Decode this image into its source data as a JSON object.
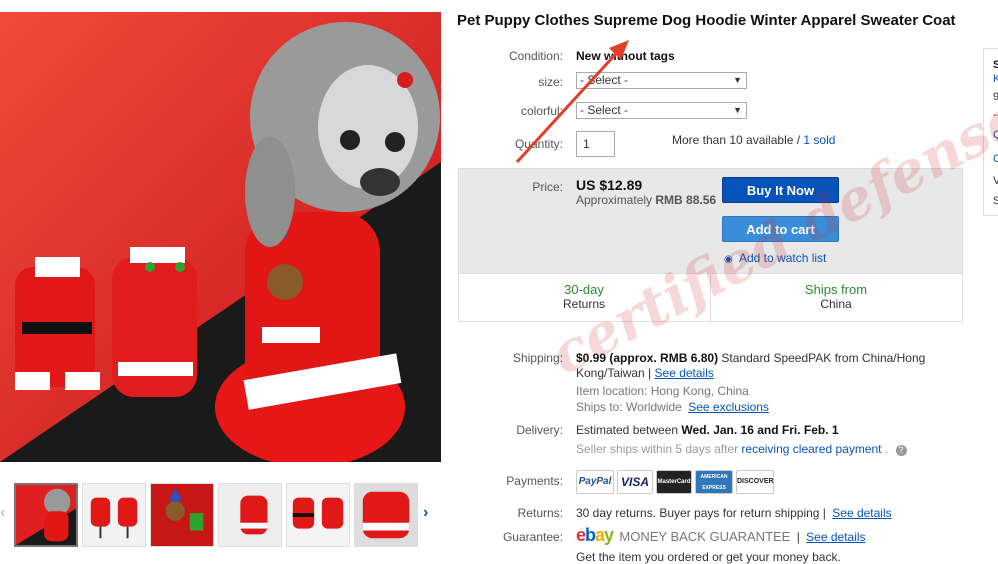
{
  "product": {
    "title": "Pet Puppy Clothes Supreme Dog Hoodie Winter Apparel Sweater Coat"
  },
  "options": {
    "condition_label": "Condition:",
    "condition_value": "New without tags",
    "size_label": "size:",
    "size_selected": "- Select -",
    "color_label": "colorful:",
    "color_selected": "- Select -",
    "quantity_label": "Quantity:",
    "quantity_value": "1",
    "available_text": "More than 10 available / ",
    "sold_link": "1 sold"
  },
  "price": {
    "label": "Price:",
    "value": "US $12.89",
    "approx_prefix": "Approximately ",
    "approx_value": "RMB 88.56",
    "buy_label": "Buy It Now",
    "cart_label": "Add to cart",
    "watch_label": "Add to watch list",
    "returns_highlight": "30-day",
    "returns_label": "Returns",
    "ships_highlight": "Ships from",
    "ships_label": "China"
  },
  "shipping": {
    "label": "Shipping:",
    "cost": "$0.99",
    "approx": "(approx. RMB 6.80)",
    "method_line1": "Standard SpeedPAK from China/Hong",
    "method_line2": "Kong/Taiwan |",
    "details_link": "See details",
    "location_label": "Item location:",
    "location_value": "Hong Kong, China",
    "ships_to_label": "Ships to:",
    "ships_to_value": "Worldwide",
    "exclusions_link": "See exclusions"
  },
  "delivery": {
    "label": "Delivery:",
    "prefix": "Estimated between ",
    "dates": "Wed. Jan. 16 and Fri. Feb. 1",
    "note": "Seller ships within 5 days after ",
    "note_link": "receiving cleared payment",
    "note_end": "."
  },
  "payments": {
    "label": "Payments:",
    "methods": [
      "PayPal",
      "VISA",
      "MasterCard",
      "AMERICAN EXPRESS",
      "DISCOVER"
    ]
  },
  "returns": {
    "label": "Returns:",
    "text": "30 day returns. Buyer pays for return shipping |",
    "link": "See details"
  },
  "guarantee": {
    "label": "Guarantee:",
    "brand": "MONEY BACK GUARANTEE",
    "separator": "|",
    "link": "See details",
    "tagline": "Get the item you ordered or get your money back."
  },
  "watermark": "certified defense",
  "sidebar": {
    "fragments": [
      "S",
      "K",
      "9",
      "--",
      "Q",
      "C",
      "V",
      "S"
    ]
  },
  "thumbnails": [
    "thumb-1",
    "thumb-2",
    "thumb-3",
    "thumb-4",
    "thumb-5",
    "thumb-6"
  ],
  "colors": {
    "link": "#0654ba",
    "buy_button": "#0654ba",
    "cart_button": "#3a8dd8",
    "green": "#2e8b2e",
    "panel": "#e8e8e8",
    "red": "#d51c1c"
  }
}
